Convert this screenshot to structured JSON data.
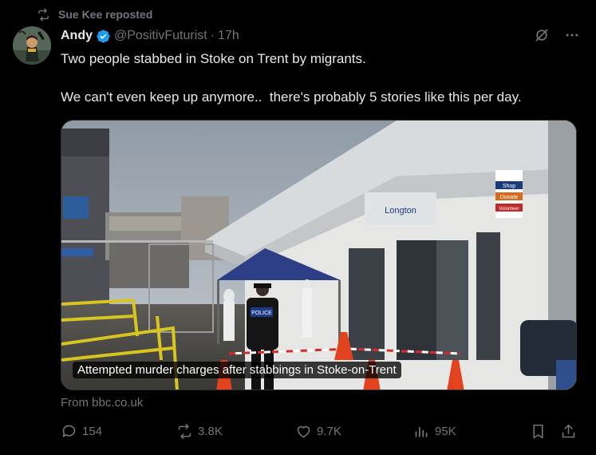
{
  "repost": {
    "text": "Sue Kee reposted",
    "icon": "repost-icon"
  },
  "author": {
    "name": "Andy",
    "handle": "@PositivFuturist",
    "separator": "·",
    "time": "17h",
    "verified_color": "#1d9bf0"
  },
  "tweet": {
    "line1": "Two people stabbed in Stoke on Trent by migrants.",
    "line2": "We can't even keep up anymore..  there's probably 5 stories like this per day."
  },
  "card": {
    "caption": "Attempted murder charges after stabbings in Stoke-on-Trent",
    "source": "From bbc.co.uk",
    "sign_shop": "Shop",
    "sign_donate": "Donate",
    "sign_volunteer": "Volunteer",
    "police_label": "POLICE",
    "building_sign": "Longton"
  },
  "actions": {
    "replies": "154",
    "reposts": "3.8K",
    "likes": "9.7K",
    "views": "95K"
  },
  "colors": {
    "background": "#000000",
    "muted": "#71767b",
    "text": "#e7e9ea",
    "accent": "#1d9bf0"
  }
}
